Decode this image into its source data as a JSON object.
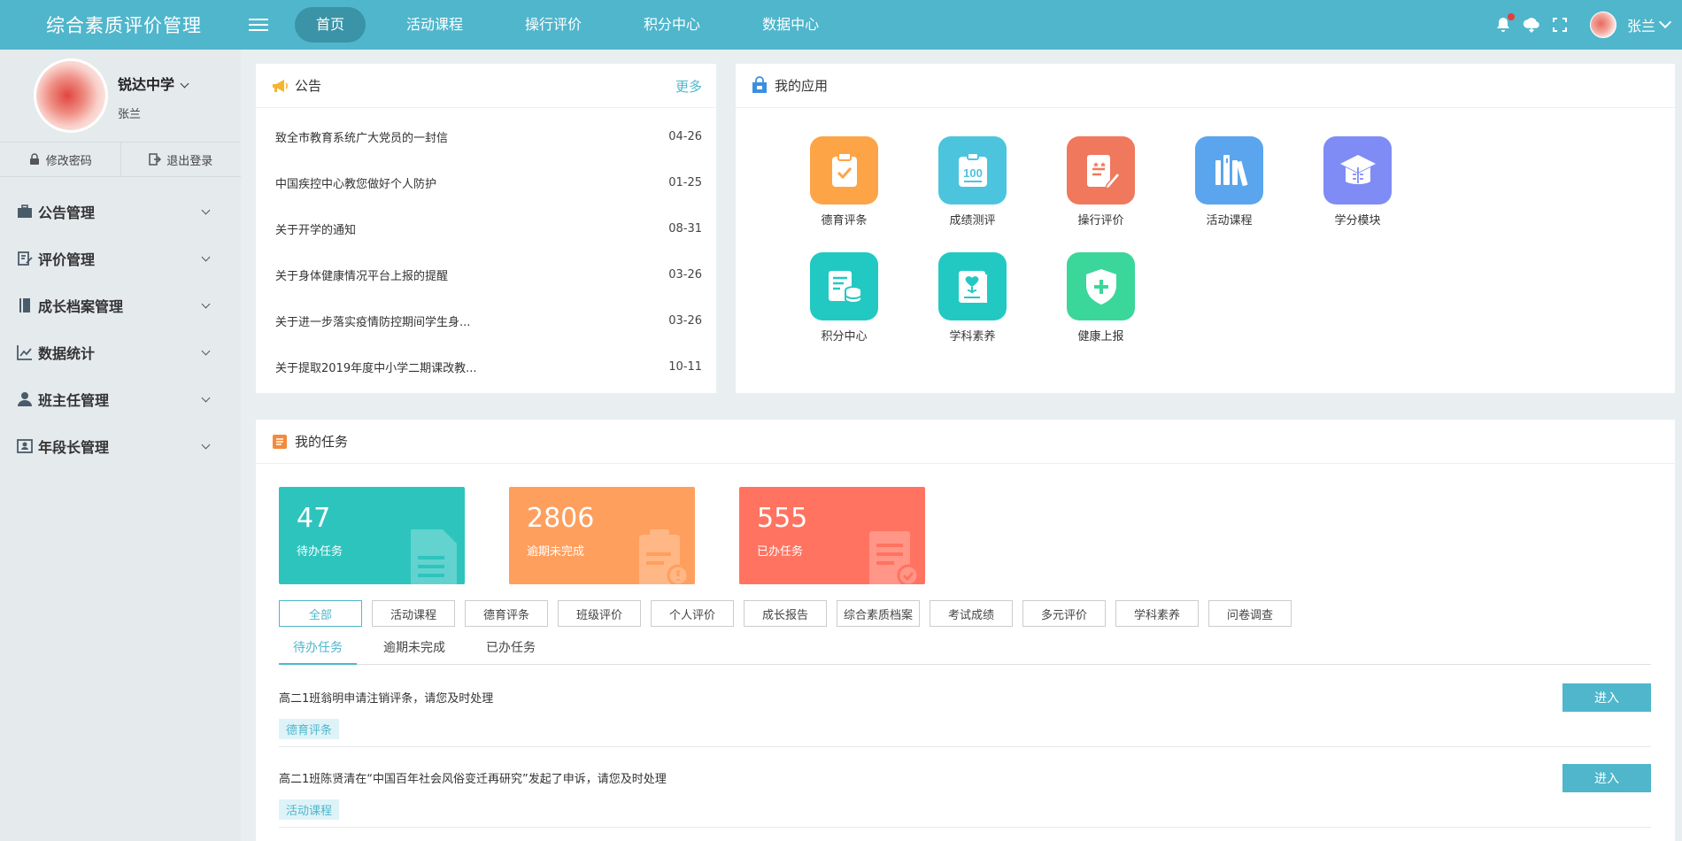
{
  "header": {
    "app_title": "综合素质评价管理",
    "nav": [
      "首页",
      "活动课程",
      "操行评价",
      "积分中心",
      "数据中心"
    ],
    "active_nav": "首页",
    "user_name": "张兰",
    "icons": [
      "bell-icon",
      "cloud-icon",
      "fullscreen-icon"
    ]
  },
  "sidebar": {
    "school": "锐达中学",
    "user": "张兰",
    "change_password": "修改密码",
    "logout": "退出登录",
    "menu": [
      "公告管理",
      "评价管理",
      "成长档案管理",
      "数据统计",
      "班主任管理",
      "年段长管理"
    ]
  },
  "notice": {
    "title": "公告",
    "more": "更多",
    "items": [
      {
        "title": "致全市教育系统广大党员的一封信",
        "date": "04-26"
      },
      {
        "title": "中国疾控中心教您做好个人防护",
        "date": "01-25"
      },
      {
        "title": "关于开学的通知",
        "date": "08-31"
      },
      {
        "title": "关于身体健康情况平台上报的提醒",
        "date": "03-26"
      },
      {
        "title": "关于进一步落实疫情防控期间学生身...",
        "date": "03-26"
      },
      {
        "title": "关于提取2019年度中小学二期课改教...",
        "date": "10-11"
      }
    ]
  },
  "apps": {
    "title": "我的应用",
    "items": [
      {
        "label": "德育评条",
        "color": "#fda447"
      },
      {
        "label": "成绩测评",
        "color": "#4cc4de"
      },
      {
        "label": "操行评价",
        "color": "#f0785c"
      },
      {
        "label": "活动课程",
        "color": "#5aa5ee"
      },
      {
        "label": "学分模块",
        "color": "#7f8cf6"
      },
      {
        "label": "积分中心",
        "color": "#22c9c2"
      },
      {
        "label": "学科素养",
        "color": "#22c9c2"
      },
      {
        "label": "健康上报",
        "color": "#3bd69a"
      }
    ]
  },
  "tasks": {
    "title": "我的任务",
    "stats": [
      {
        "num": "47",
        "label": "待办任务",
        "color": "#2ec4be"
      },
      {
        "num": "2806",
        "label": "逾期未完成",
        "color": "#ff9f5e"
      },
      {
        "num": "555",
        "label": "已办任务",
        "color": "#ff7360"
      }
    ],
    "filters": [
      "全部",
      "活动课程",
      "德育评条",
      "班级评价",
      "个人评价",
      "成长报告",
      "综合素质档案",
      "考试成绩",
      "多元评价",
      "学科素养",
      "问卷调查"
    ],
    "active_filter": "全部",
    "tabs": [
      "待办任务",
      "逾期未完成",
      "已办任务"
    ],
    "active_tab": "待办任务",
    "list": [
      {
        "text": "高二1班翁明申请注销评条，请您及时处理",
        "tag": "德育评条",
        "action": "进入"
      },
      {
        "text": "高二1班陈贤清在“中国百年社会风俗变迁再研究”发起了申诉，请您及时处理",
        "tag": "活动课程",
        "action": "进入"
      }
    ]
  }
}
